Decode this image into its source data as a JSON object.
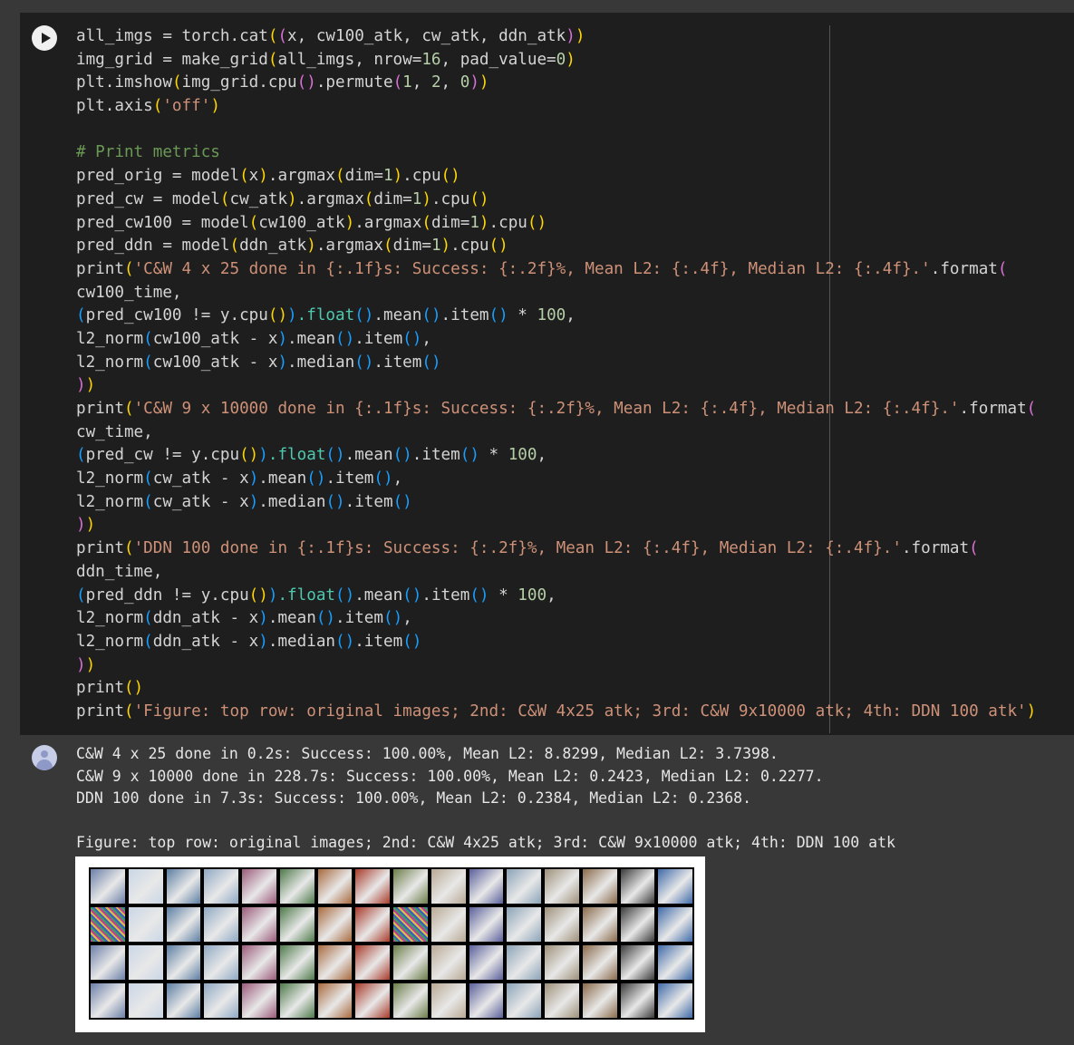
{
  "code_lines": [
    [
      [
        "all_imgs = torch.cat",
        "kw"
      ],
      [
        "(",
        "p1"
      ],
      [
        "(",
        "p2"
      ],
      [
        "x, cw100_atk, cw_atk, ddn_atk",
        "kw"
      ],
      [
        ")",
        "p2"
      ],
      [
        ")",
        "p1"
      ]
    ],
    [
      [
        "img_grid = make_grid",
        "kw"
      ],
      [
        "(",
        "p1"
      ],
      [
        "all_imgs, nrow=",
        "kw"
      ],
      [
        "16",
        "num"
      ],
      [
        ", pad_value=",
        "kw"
      ],
      [
        "0",
        "num"
      ],
      [
        ")",
        "p1"
      ]
    ],
    [
      [
        "plt.imshow",
        "kw"
      ],
      [
        "(",
        "p1"
      ],
      [
        "img_grid.cpu",
        "kw"
      ],
      [
        "()",
        "p2"
      ],
      [
        ".permute",
        "kw"
      ],
      [
        "(",
        "p2"
      ],
      [
        "1",
        "num"
      ],
      [
        ", ",
        "kw"
      ],
      [
        "2",
        "num"
      ],
      [
        ", ",
        "kw"
      ],
      [
        "0",
        "num"
      ],
      [
        ")",
        "p2"
      ],
      [
        ")",
        "p1"
      ]
    ],
    [
      [
        "plt.axis",
        "kw"
      ],
      [
        "(",
        "p1"
      ],
      [
        "'off'",
        "str"
      ],
      [
        ")",
        "p1"
      ]
    ],
    [],
    [
      [
        "# Print metrics",
        "cm"
      ]
    ],
    [
      [
        "pred_orig = model",
        "kw"
      ],
      [
        "(",
        "p1"
      ],
      [
        "x",
        "kw"
      ],
      [
        ")",
        "p1"
      ],
      [
        ".argmax",
        "kw"
      ],
      [
        "(",
        "p1"
      ],
      [
        "dim=",
        "kw"
      ],
      [
        "1",
        "num"
      ],
      [
        ")",
        "p1"
      ],
      [
        ".cpu",
        "kw"
      ],
      [
        "()",
        "p1"
      ]
    ],
    [
      [
        "pred_cw = model",
        "kw"
      ],
      [
        "(",
        "p1"
      ],
      [
        "cw_atk",
        "kw"
      ],
      [
        ")",
        "p1"
      ],
      [
        ".argmax",
        "kw"
      ],
      [
        "(",
        "p1"
      ],
      [
        "dim=",
        "kw"
      ],
      [
        "1",
        "num"
      ],
      [
        ")",
        "p1"
      ],
      [
        ".cpu",
        "kw"
      ],
      [
        "()",
        "p1"
      ]
    ],
    [
      [
        "pred_cw100 = model",
        "kw"
      ],
      [
        "(",
        "p1"
      ],
      [
        "cw100_atk",
        "kw"
      ],
      [
        ")",
        "p1"
      ],
      [
        ".argmax",
        "kw"
      ],
      [
        "(",
        "p1"
      ],
      [
        "dim=",
        "kw"
      ],
      [
        "1",
        "num"
      ],
      [
        ")",
        "p1"
      ],
      [
        ".cpu",
        "kw"
      ],
      [
        "()",
        "p1"
      ]
    ],
    [
      [
        "pred_ddn = model",
        "kw"
      ],
      [
        "(",
        "p1"
      ],
      [
        "ddn_atk",
        "kw"
      ],
      [
        ")",
        "p1"
      ],
      [
        ".argmax",
        "kw"
      ],
      [
        "(",
        "p1"
      ],
      [
        "dim=",
        "kw"
      ],
      [
        "1",
        "num"
      ],
      [
        ")",
        "p1"
      ],
      [
        ".cpu",
        "kw"
      ],
      [
        "()",
        "p1"
      ]
    ],
    [
      [
        "print",
        "kw"
      ],
      [
        "(",
        "p1"
      ],
      [
        "'C&W 4 x 25 done in {:.1f}s: Success: {:.2f}%, Mean L2: {:.4f}, Median L2: {:.4f}.'",
        "str"
      ],
      [
        ".format",
        "kw"
      ],
      [
        "(",
        "p2"
      ]
    ],
    [
      [
        "cw100_time,",
        "kw"
      ]
    ],
    [
      [
        "(",
        "p3"
      ],
      [
        "pred_cw100 != y.cpu",
        "kw"
      ],
      [
        "()",
        "p1"
      ],
      [
        ")",
        "p3"
      ],
      [
        ".float",
        "bi"
      ],
      [
        "()",
        "p3"
      ],
      [
        ".mean",
        "kw"
      ],
      [
        "()",
        "p3"
      ],
      [
        ".item",
        "kw"
      ],
      [
        "()",
        "p3"
      ],
      [
        " * ",
        "kw"
      ],
      [
        "100",
        "num"
      ],
      [
        ",",
        "kw"
      ]
    ],
    [
      [
        "l2_norm",
        "kw"
      ],
      [
        "(",
        "p3"
      ],
      [
        "cw100_atk - x",
        "kw"
      ],
      [
        ")",
        "p3"
      ],
      [
        ".mean",
        "kw"
      ],
      [
        "()",
        "p3"
      ],
      [
        ".item",
        "kw"
      ],
      [
        "()",
        "p3"
      ],
      [
        ",",
        "kw"
      ]
    ],
    [
      [
        "l2_norm",
        "kw"
      ],
      [
        "(",
        "p3"
      ],
      [
        "cw100_atk - x",
        "kw"
      ],
      [
        ")",
        "p3"
      ],
      [
        ".median",
        "kw"
      ],
      [
        "()",
        "p3"
      ],
      [
        ".item",
        "kw"
      ],
      [
        "()",
        "p3"
      ]
    ],
    [
      [
        ")",
        "p2"
      ],
      [
        ")",
        "p1"
      ]
    ],
    [
      [
        "print",
        "kw"
      ],
      [
        "(",
        "p1"
      ],
      [
        "'C&W 9 x 10000 done in {:.1f}s: Success: {:.2f}%, Mean L2: {:.4f}, Median L2: {:.4f}.'",
        "str"
      ],
      [
        ".format",
        "kw"
      ],
      [
        "(",
        "p2"
      ]
    ],
    [
      [
        "cw_time,",
        "kw"
      ]
    ],
    [
      [
        "(",
        "p3"
      ],
      [
        "pred_cw != y.cpu",
        "kw"
      ],
      [
        "()",
        "p1"
      ],
      [
        ")",
        "p3"
      ],
      [
        ".float",
        "bi"
      ],
      [
        "()",
        "p3"
      ],
      [
        ".mean",
        "kw"
      ],
      [
        "()",
        "p3"
      ],
      [
        ".item",
        "kw"
      ],
      [
        "()",
        "p3"
      ],
      [
        " * ",
        "kw"
      ],
      [
        "100",
        "num"
      ],
      [
        ",",
        "kw"
      ]
    ],
    [
      [
        "l2_norm",
        "kw"
      ],
      [
        "(",
        "p3"
      ],
      [
        "cw_atk - x",
        "kw"
      ],
      [
        ")",
        "p3"
      ],
      [
        ".mean",
        "kw"
      ],
      [
        "()",
        "p3"
      ],
      [
        ".item",
        "kw"
      ],
      [
        "()",
        "p3"
      ],
      [
        ",",
        "kw"
      ]
    ],
    [
      [
        "l2_norm",
        "kw"
      ],
      [
        "(",
        "p3"
      ],
      [
        "cw_atk - x",
        "kw"
      ],
      [
        ")",
        "p3"
      ],
      [
        ".median",
        "kw"
      ],
      [
        "()",
        "p3"
      ],
      [
        ".item",
        "kw"
      ],
      [
        "()",
        "p3"
      ]
    ],
    [
      [
        ")",
        "p2"
      ],
      [
        ")",
        "p1"
      ]
    ],
    [
      [
        "print",
        "kw"
      ],
      [
        "(",
        "p1"
      ],
      [
        "'DDN 100 done in {:.1f}s: Success: {:.2f}%, Mean L2: {:.4f}, Median L2: {:.4f}.'",
        "str"
      ],
      [
        ".format",
        "kw"
      ],
      [
        "(",
        "p2"
      ]
    ],
    [
      [
        "ddn_time,",
        "kw"
      ]
    ],
    [
      [
        "(",
        "p3"
      ],
      [
        "pred_ddn != y.cpu",
        "kw"
      ],
      [
        "()",
        "p1"
      ],
      [
        ")",
        "p3"
      ],
      [
        ".float",
        "bi"
      ],
      [
        "()",
        "p3"
      ],
      [
        ".mean",
        "kw"
      ],
      [
        "()",
        "p3"
      ],
      [
        ".item",
        "kw"
      ],
      [
        "()",
        "p3"
      ],
      [
        " * ",
        "kw"
      ],
      [
        "100",
        "num"
      ],
      [
        ",",
        "kw"
      ]
    ],
    [
      [
        "l2_norm",
        "kw"
      ],
      [
        "(",
        "p3"
      ],
      [
        "ddn_atk - x",
        "kw"
      ],
      [
        ")",
        "p3"
      ],
      [
        ".mean",
        "kw"
      ],
      [
        "()",
        "p3"
      ],
      [
        ".item",
        "kw"
      ],
      [
        "()",
        "p3"
      ],
      [
        ",",
        "kw"
      ]
    ],
    [
      [
        "l2_norm",
        "kw"
      ],
      [
        "(",
        "p3"
      ],
      [
        "ddn_atk - x",
        "kw"
      ],
      [
        ")",
        "p3"
      ],
      [
        ".median",
        "kw"
      ],
      [
        "()",
        "p3"
      ],
      [
        ".item",
        "kw"
      ],
      [
        "()",
        "p3"
      ]
    ],
    [
      [
        ")",
        "p2"
      ],
      [
        ")",
        "p1"
      ]
    ],
    [
      [
        "print",
        "kw"
      ],
      [
        "()",
        "p1"
      ]
    ],
    [
      [
        "print",
        "kw"
      ],
      [
        "(",
        "p1"
      ],
      [
        "'Figure: top row: original images; 2nd: C&W 4x25 atk; 3rd: C&W 9x10000 atk; 4th: DDN 100 atk'",
        "str"
      ],
      [
        ")",
        "p1"
      ]
    ]
  ],
  "output": {
    "lines": [
      "C&W 4 x 25 done in 0.2s: Success: 100.00%, Mean L2: 8.8299, Median L2: 3.7398.",
      "C&W 9 x 10000 done in 228.7s: Success: 100.00%, Mean L2: 0.2423, Median L2: 0.2277.",
      "DDN 100 done in 7.3s: Success: 100.00%, Mean L2: 0.2384, Median L2: 0.2368.",
      "",
      "Figure: top row: original images; 2nd: C&W 4x25 atk; 3rd: C&W 9x10000 atk; 4th: DDN 100 atk"
    ]
  },
  "image_grid": {
    "rows": 4,
    "cols": 16,
    "tile_colors": [
      "#6b7fa8",
      "#c9d6e6",
      "#5c7ea3",
      "#8fa9c4",
      "#9b5a7a",
      "#4e7a4a",
      "#a86a3e",
      "#a83a2a",
      "#6c7d4a",
      "#b8a994",
      "#5a5f9a",
      "#8aa3b8",
      "#9e9078",
      "#8a6a4a",
      "#3a3a3a",
      "#3f6aa8"
    ],
    "noisy_tiles": [
      [
        1,
        0
      ],
      [
        1,
        8
      ]
    ]
  }
}
